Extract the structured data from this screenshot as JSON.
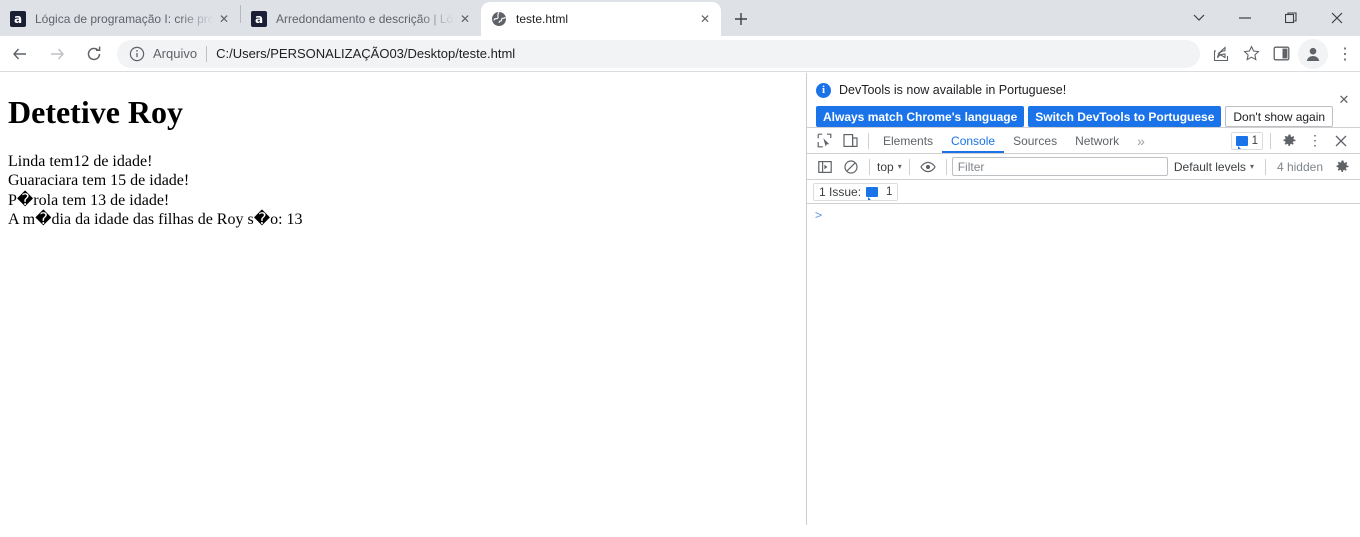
{
  "window": {
    "controls": [
      {
        "name": "tab-search",
        "label": "⌄"
      },
      {
        "name": "minimize",
        "label": "—"
      },
      {
        "name": "maximize",
        "label": "❐"
      },
      {
        "name": "close",
        "label": "✕"
      }
    ]
  },
  "tabs": [
    {
      "title": "Lógica de programação I: crie pro",
      "favicon": "alura-icon",
      "active": false,
      "close_label": "✕"
    },
    {
      "title": "Arredondamento e descrição | Ló",
      "favicon": "alura-icon",
      "active": false,
      "close_label": "✕"
    },
    {
      "title": "teste.html",
      "favicon": "globe-icon",
      "active": true,
      "close_label": "✕"
    }
  ],
  "newtab_label": "+",
  "toolbar": {
    "back_label": "←",
    "forward_label": "→",
    "reload_label": "↻",
    "omnibox": {
      "scheme_label": "Arquivo",
      "url": "C:/Users/PERSONALIZAÇÃO03/Desktop/teste.html"
    },
    "share_label": "share-icon",
    "bookmark_label": "☆",
    "sidepanel_label": "side-panel-icon",
    "profile_label": "profile-avatar",
    "menu_label": "⋮"
  },
  "page": {
    "heading": "Detetive Roy",
    "lines": [
      "Linda tem12 de idade!",
      "Guaraciara tem 15 de idade!",
      "P�rola tem 13 de idade!",
      "A m�dia da idade das filhas de Roy s�o: 13"
    ]
  },
  "devtools": {
    "banner": {
      "info_glyph": "i",
      "message": "DevTools is now available in Portuguese!",
      "primary_button": "Always match Chrome's language",
      "secondary_button": "Switch DevTools to Portuguese",
      "dismiss_button": "Don't show again",
      "close_label": "✕"
    },
    "tabs": [
      {
        "label": "Elements",
        "active": false
      },
      {
        "label": "Console",
        "active": true
      },
      {
        "label": "Sources",
        "active": false
      },
      {
        "label": "Network",
        "active": false
      }
    ],
    "tabs_overflow_label": "»",
    "inspect_icon": "inspect-element-icon",
    "device_icon": "device-toolbar-icon",
    "message_badge_count": "1",
    "settings_label": "gear-icon",
    "more_label": "⋮",
    "close_label": "✕",
    "console_toolbar": {
      "sidebar_toggle": "console-sidebar-icon",
      "clear_label": "clear-console-icon",
      "context": "top",
      "context_caret": "▾",
      "eye_label": "live-expression-icon",
      "filter_placeholder": "Filter",
      "filter_value": "",
      "levels": "Default levels",
      "levels_caret": "▾",
      "hidden_text": "4 hidden",
      "settings_label": "console-settings-icon"
    },
    "issues_bar": {
      "text": "1 Issue:",
      "count": "1"
    },
    "prompt": ">"
  },
  "colors": {
    "accent_blue": "#1a73e8",
    "tabstrip": "#dee1e6",
    "omnibox_bg": "#f1f3f4",
    "border": "#d0d0d0"
  }
}
